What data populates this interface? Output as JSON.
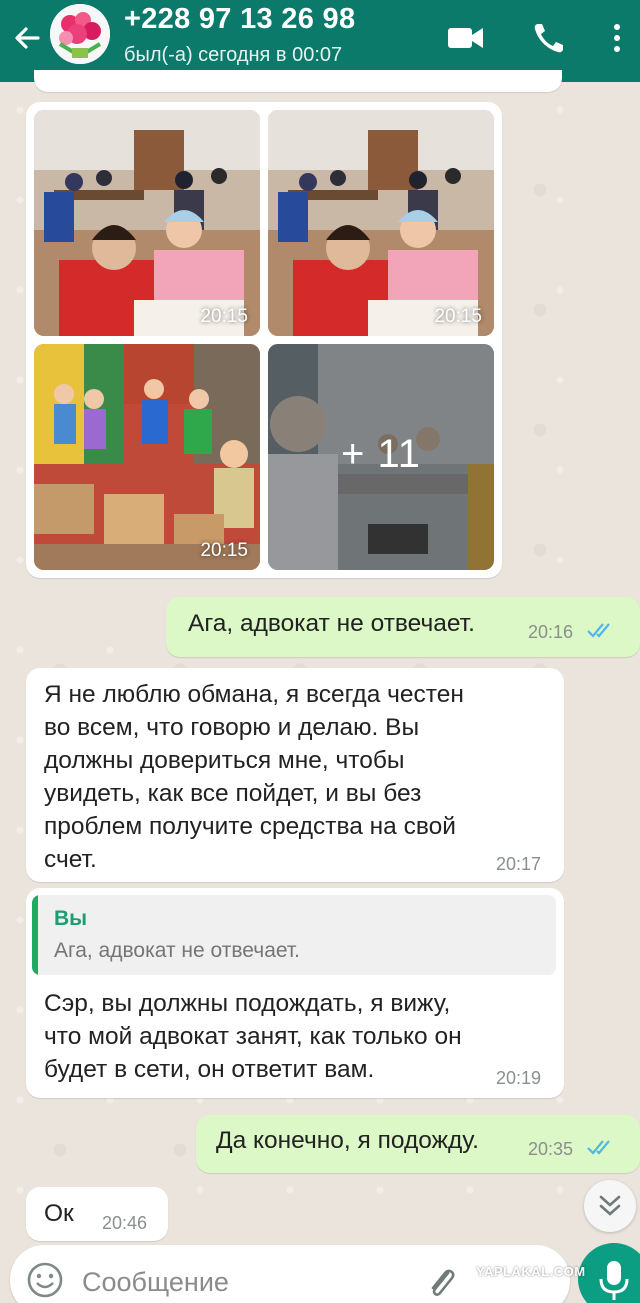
{
  "header": {
    "contact_name": "+228 97 13 26 98",
    "status": "был(-а) сегодня в 00:07",
    "icons": [
      "back-arrow-icon",
      "video-call-icon",
      "phone-icon",
      "more-vert-icon"
    ]
  },
  "photos": {
    "times": [
      "20:15",
      "20:15",
      "20:15"
    ],
    "more_count": "+ 11"
  },
  "messages": [
    {
      "direction": "out",
      "text": "Ага, адвокат не отвечает.",
      "time": "20:16",
      "read": true
    },
    {
      "direction": "in",
      "lines": [
        "Я не люблю обмана, я всегда честен",
        "во всем, что говорю и делаю.  Вы",
        "должны довериться мне, чтобы",
        "увидеть, как все пойдет, и вы без",
        "проблем получите средства на свой",
        "счет."
      ],
      "time": "20:17"
    },
    {
      "direction": "in",
      "quote": {
        "author": "Вы",
        "text": "Ага, адвокат не отвечает."
      },
      "lines": [
        "Сэр, вы должны подождать, я вижу,",
        "что мой адвокат занят, как только он",
        "будет в сети, он ответит вам."
      ],
      "time": "20:19"
    },
    {
      "direction": "out",
      "text": "Да конечно, я подожду.",
      "time": "20:35",
      "read": true
    },
    {
      "direction": "in",
      "text": "Ок",
      "time": "20:46"
    }
  ],
  "input": {
    "placeholder": "Сообщение"
  },
  "watermark": "YAPLAKAL.COM",
  "colors": {
    "header": "#0b7a6b",
    "outgoing_bubble": "#dcf8c6",
    "incoming_bubble": "#ffffff",
    "read_ticks": "#4fb6ec",
    "mic_button": "#0b9e82"
  }
}
